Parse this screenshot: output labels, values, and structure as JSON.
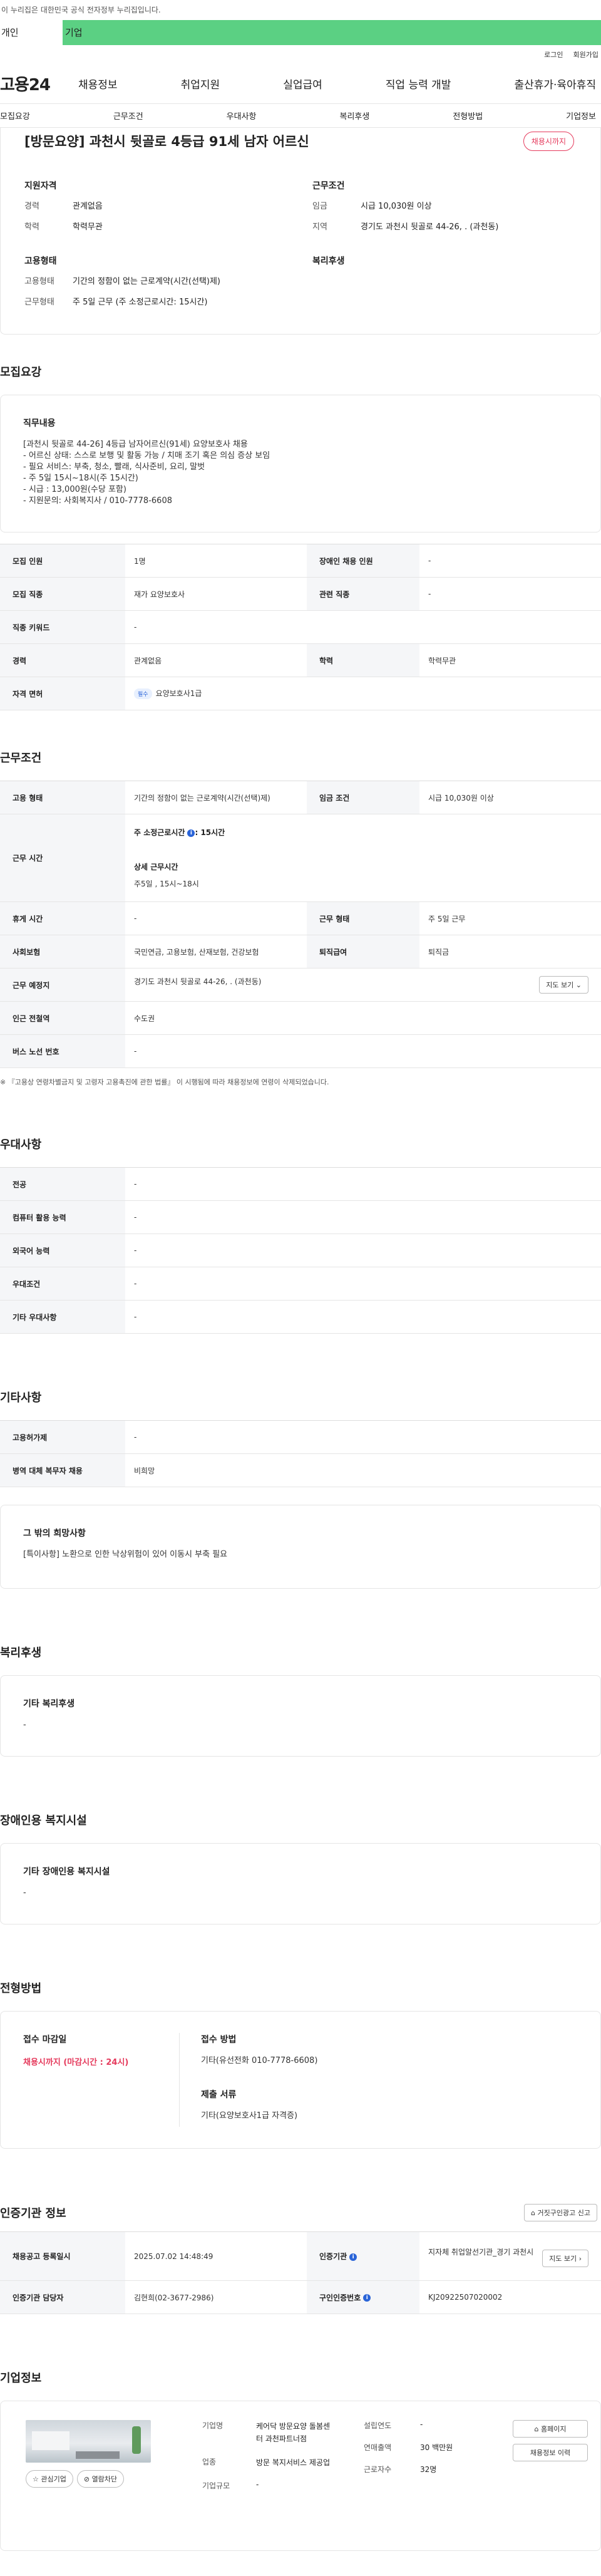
{
  "gov_notice": "이 누리집은 대한민국 공식 전자정부 누리집입니다.",
  "site_tabs": [
    "개인",
    "기업"
  ],
  "util_links": [
    "로그인",
    "회원가입"
  ],
  "logo": "고용24",
  "gnb": [
    "채용정보",
    "취업지원",
    "실업급여",
    "직업 능력 개발",
    "출산휴가·육아휴직"
  ],
  "subnav": [
    "모집요강",
    "근무조건",
    "우대사항",
    "복리후생",
    "전형방법",
    "기업정보"
  ],
  "job": {
    "title": "[방문요양] 과천시 뒷골로 4등급 91세 남자 어르신",
    "badge": "채용시까지",
    "qual_heading": "지원자격",
    "career_label": "경력",
    "career": "관계없음",
    "edu_label": "학력",
    "edu": "학력무관",
    "emp_heading": "고용형태",
    "emp_type": "기간의 정함이 없는 근로계약(시간(선택)제)",
    "work_form_label": "근무형태",
    "work_form": "주 5일 근무 (주 소정근로시간: 15시간)",
    "cond_heading": "근무조건",
    "wage_label": "임금",
    "wage": "시급 10,030원 이상",
    "region_label": "지역",
    "region": "경기도 과천시 뒷골로 44-26, . (과천동)",
    "welfare_heading": "복리후생"
  },
  "recruit": {
    "section": "모집요강",
    "duty_title": "직무내용",
    "duty_text": "[과천시 뒷골로 44-26] 4등급 남자어르신(91세) 요양보호사 채용\n- 어르신 상태: 스스로 보행 및 활동 가능 / 치매 조기 혹은 의심 증상 보임\n- 필요 서비스: 부축, 청소, 빨래, 식사준비, 요리, 말벗\n- 주 5일 15시~18시(주 15시간)\n- 시급 : 13,000원(수당 포함)\n- 지원문의: 사회복지사 / 010-7778-6608",
    "rows": [
      {
        "k1": "모집 인원",
        "v1": "1명",
        "k2": "장애인 채용 인원",
        "v2": "-"
      },
      {
        "k1": "모집 직종",
        "v1": "재가 요양보호사",
        "k2": "관련 직종",
        "v2": "-"
      },
      {
        "k1": "직종 키워드",
        "v1": "-"
      },
      {
        "k1": "경력",
        "v1": "관계없음",
        "k2": "학력",
        "v2": "학력무관"
      }
    ],
    "license_label": "자격 면허",
    "license_chip": "필수",
    "license": "요양보호사1급"
  },
  "conditions": {
    "section": "근무조건",
    "emp_label": "고용 형태",
    "emp": "기간의 정함이 없는 근로계약(시간(선택)제)",
    "wage_label": "임금 조건",
    "wage": "시급 10,030원 이상",
    "hours_label": "근무 시간",
    "weekly_hours": "주 소정근로시간",
    "weekly_hours_val": ": 15시간",
    "detail_hours_title": "상세 근무시간",
    "detail_hours": "주5일 , 15시~18시",
    "holiday_label": "휴게 시간",
    "holiday": "-",
    "work_form_label": "근무 형태",
    "work_form": "주 5일 근무",
    "insurance_label": "사회보험",
    "insurance": "국민연금, 고용보험, 산재보험, 건강보험",
    "severance_label": "퇴직급여",
    "severance": "퇴직금",
    "place_label": "근무 예정지",
    "place": "경기도 과천시 뒷골로 44-26, . (과천동)",
    "map_button": "지도 보기",
    "subway_label": "인근 전철역",
    "subway": "수도권",
    "bus_label": "버스 노선 번호",
    "bus": "-",
    "note": "※ 『고용상 연령차별금지 및 고령자 고용촉진에 관한 법률』 이 시행됨에 따라 채용정보에 연령이 삭제되었습니다."
  },
  "preference": {
    "section": "우대사항",
    "rows": [
      {
        "k": "전공",
        "v": "-"
      },
      {
        "k": "컴퓨터 활용 능력",
        "v": "-"
      },
      {
        "k": "외국어 능력",
        "v": "-"
      },
      {
        "k": "우대조건",
        "v": "-"
      },
      {
        "k": "기타 우대사항",
        "v": "-"
      }
    ]
  },
  "etc": {
    "section": "기타사항",
    "rows": [
      {
        "k": "고용허가제",
        "v": "-"
      },
      {
        "k": "병역 대체 복무자 채용",
        "v": "비희망"
      }
    ],
    "hope_title": "그 밖의 희망사항",
    "hope_text": "[특이사항] 노환으로 인한 낙상위험이 있어 이동시 부축 필요"
  },
  "welfare": {
    "section": "복리후생",
    "title": "기타 복리후생",
    "text": "-"
  },
  "disabled": {
    "section": "장애인용 복지시설",
    "title": "기타 장애인용 복지시설",
    "text": "-"
  },
  "selection": {
    "section": "전형방법",
    "deadline_title": "접수 마감일",
    "deadline": "채용시까지 (마감시간 : 24시)",
    "method_title": "접수 방법",
    "method": "기타(유선전화 010-7778-6608)",
    "docs_title": "제출 서류",
    "docs": "기타(요양보호사1급 자격증)"
  },
  "cert": {
    "section": "인증기관 정보",
    "report_button": "거짓구인광고 신고",
    "reg_label": "채용공고 등록일시",
    "reg": "2025.07.02 14:48:49",
    "org_label": "인증기관",
    "org": "지자체 취업알선기관_경기 과천시",
    "org_button": "지도 보기",
    "mgr_label": "인증기관 담당자",
    "mgr": "김현희(02-3677-2986)",
    "num_label": "구인인증번호",
    "num": "KJ20922507020002"
  },
  "company": {
    "section": "기업정보",
    "interest_button": "관심기업",
    "block_button": "열람차단",
    "name_label": "기업명",
    "name": "케어닥 방문요양 돌봄센터 과천파트너점",
    "industry_label": "업종",
    "industry": "방문 복지서비스 제공업",
    "size_label": "기업규모",
    "size": "-",
    "year_label": "설립연도",
    "year": "-",
    "sales_label": "연매출액",
    "sales": "30 백만원",
    "staff_label": "근로자수",
    "staff": "32명",
    "home_button": "홈페이지",
    "history_button": "채용정보 이력"
  }
}
